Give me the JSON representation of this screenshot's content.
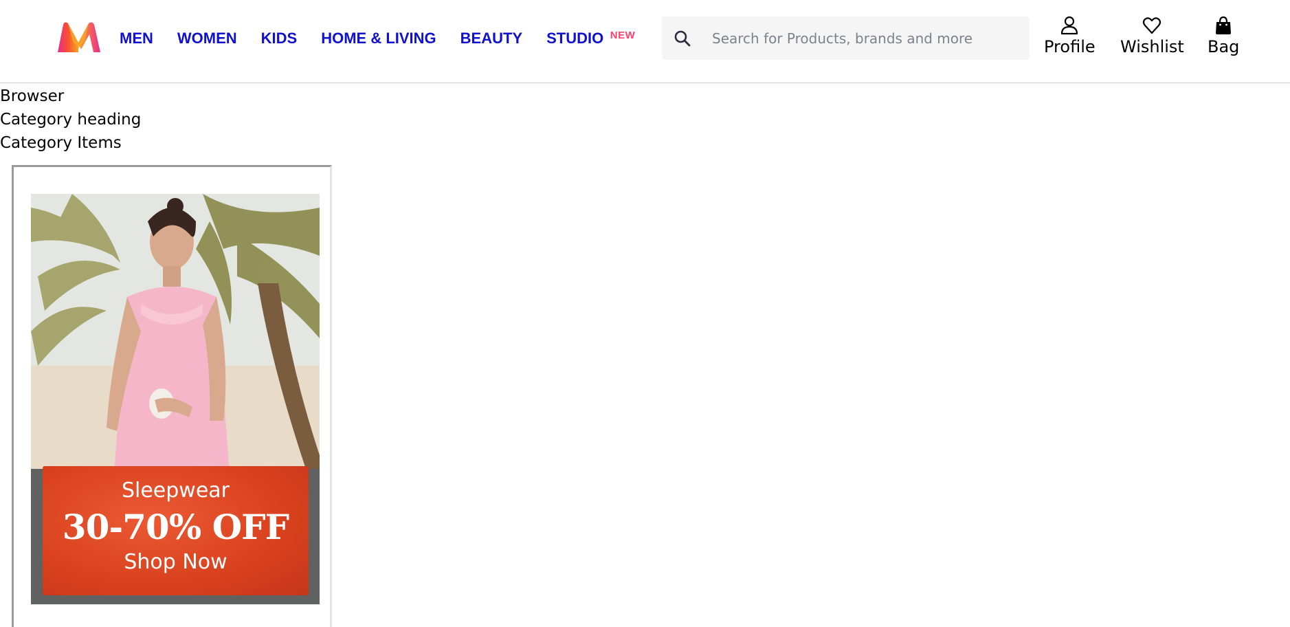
{
  "brand": {
    "logo_icon": "myntra-logo-icon",
    "colors": {
      "logo_pink": "#ff3f6c",
      "logo_orange": "#f8a226",
      "nav_blue": "#1010d0",
      "badge_pink": "#ff3f6c"
    }
  },
  "nav": {
    "men": "MEN",
    "women": "WOMEN",
    "kids": "KIDS",
    "home_living": "HOME & LIVING",
    "beauty": "BEAUTY",
    "studio": "STUDIO",
    "studio_badge": "NEW"
  },
  "search": {
    "icon": "search-icon",
    "placeholder": "Search for Products, brands and more",
    "value": ""
  },
  "actions": {
    "profile": {
      "label": "Profile",
      "icon": "user-icon"
    },
    "wishlist": {
      "label": "Wishlist",
      "icon": "heart-icon"
    },
    "bag": {
      "label": "Bag",
      "icon": "shopping-bag-icon"
    }
  },
  "page_text": {
    "line1": "Browser",
    "line2": "Category heading",
    "line3": "Category Items"
  },
  "banner": {
    "title": "Sleepwear",
    "discount": "30-70% OFF",
    "cta": "Shop Now",
    "offer_color": "#d9411d"
  }
}
